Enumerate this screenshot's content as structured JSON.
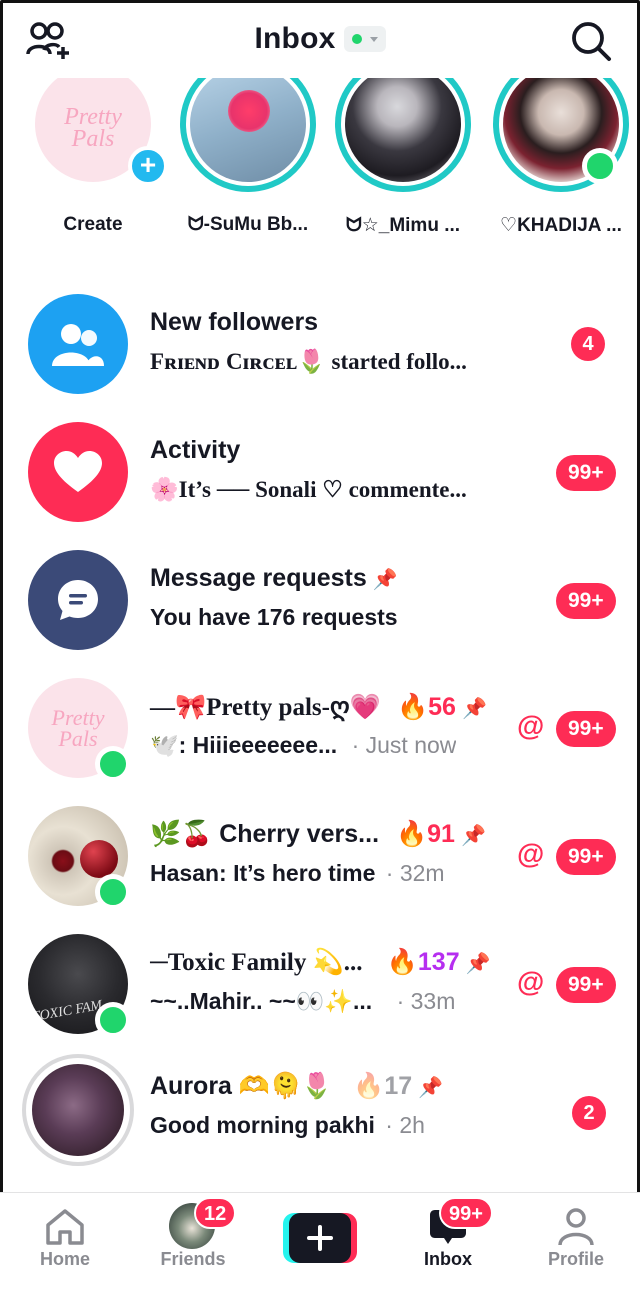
{
  "header": {
    "title": "Inbox"
  },
  "stories": [
    {
      "name": "Create",
      "kind": "create",
      "avatar_text": "Pretty Pals"
    },
    {
      "name": "ᗢ-SuMu Bb..."
    },
    {
      "name": "ᗢ☆_Mimu ..."
    },
    {
      "name": "♡KHADIJA ...",
      "online": true
    }
  ],
  "rows": [
    {
      "title": "New followers",
      "subtitle": "Fʀɪᴇɴᴅ Cɪʀᴄᴇʟ🌷 started follo...",
      "badge": "4",
      "icon": "people-icon",
      "color": "#1da1f2"
    },
    {
      "title": "Activity",
      "subtitle": "🌸It’s ── Sonali ♡ commente...",
      "badge": "99+",
      "icon": "heart-icon",
      "color": "#fe2c55"
    },
    {
      "title": "Message requests",
      "subtitle": "You have 176 requests",
      "badge": "99+",
      "icon": "message-icon",
      "color": "#3b4a78"
    },
    {
      "title": "—🎀Pretty pals-ღ💗",
      "streak": "56",
      "subtitle": "🕊️: Hiiieeeeeee...",
      "time": "· Just now",
      "badge": "99+",
      "at": "@",
      "avatar_text": "Pretty Pals"
    },
    {
      "title": "🌿🍒 Cherry vers...",
      "streak": "91",
      "subtitle": "Hasan: It’s hero time",
      "time": "· 32m",
      "badge": "99+",
      "at": "@"
    },
    {
      "title": "─Toxic Family 💫...",
      "streak": "137",
      "subtitle": "~~..Mahir.. ~~👀✨...",
      "time": "· 33m",
      "badge": "99+",
      "at": "@",
      "avatar_text": "TOXIC FAM"
    },
    {
      "title": "Aurora 🫶🫠🌷",
      "streak": "17",
      "subtitle": "Good morning pakhi",
      "time": "· 2h",
      "badge": "2"
    }
  ],
  "nav": {
    "home": "Home",
    "friends": "Friends",
    "friends_badge": "12",
    "inbox": "Inbox",
    "inbox_badge": "99+",
    "profile": "Profile"
  },
  "colors": {
    "accent": "#fe2c55",
    "online": "#20d56c",
    "story_ring": "#20c9c6"
  }
}
